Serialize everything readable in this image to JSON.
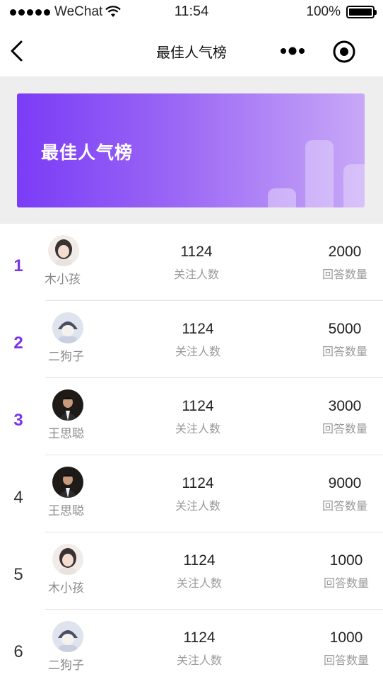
{
  "status_bar": {
    "carrier": "WeChat",
    "time": "11:54",
    "battery": "100%",
    "battery_level": 1.0
  },
  "nav": {
    "title": "最佳人气榜"
  },
  "banner": {
    "title": "最佳人气榜"
  },
  "list": {
    "rows": [
      {
        "rank": "1",
        "name": "木小孩",
        "followers": "1124",
        "followers_label": "关注人数",
        "answers": "2000",
        "answers_label": "回答数量"
      },
      {
        "rank": "2",
        "name": "二狗子",
        "followers": "1124",
        "followers_label": "关注人数",
        "answers": "5000",
        "answers_label": "回答数量"
      },
      {
        "rank": "3",
        "name": "王思聪",
        "followers": "1124",
        "followers_label": "关注人数",
        "answers": "3000",
        "answers_label": "回答数量"
      },
      {
        "rank": "4",
        "name": "王思聪",
        "followers": "1124",
        "followers_label": "关注人数",
        "answers": "9000",
        "answers_label": "回答数量"
      },
      {
        "rank": "5",
        "name": "木小孩",
        "followers": "1124",
        "followers_label": "关注人数",
        "answers": "1000",
        "answers_label": "回答数量"
      },
      {
        "rank": "6",
        "name": "二狗子",
        "followers": "1124",
        "followers_label": "关注人数",
        "answers": "1000",
        "answers_label": "回答数量"
      }
    ]
  },
  "colors": {
    "accent": "#7b33e8",
    "banner_start": "#7a3cf6",
    "banner_end": "#c8a8f7"
  }
}
